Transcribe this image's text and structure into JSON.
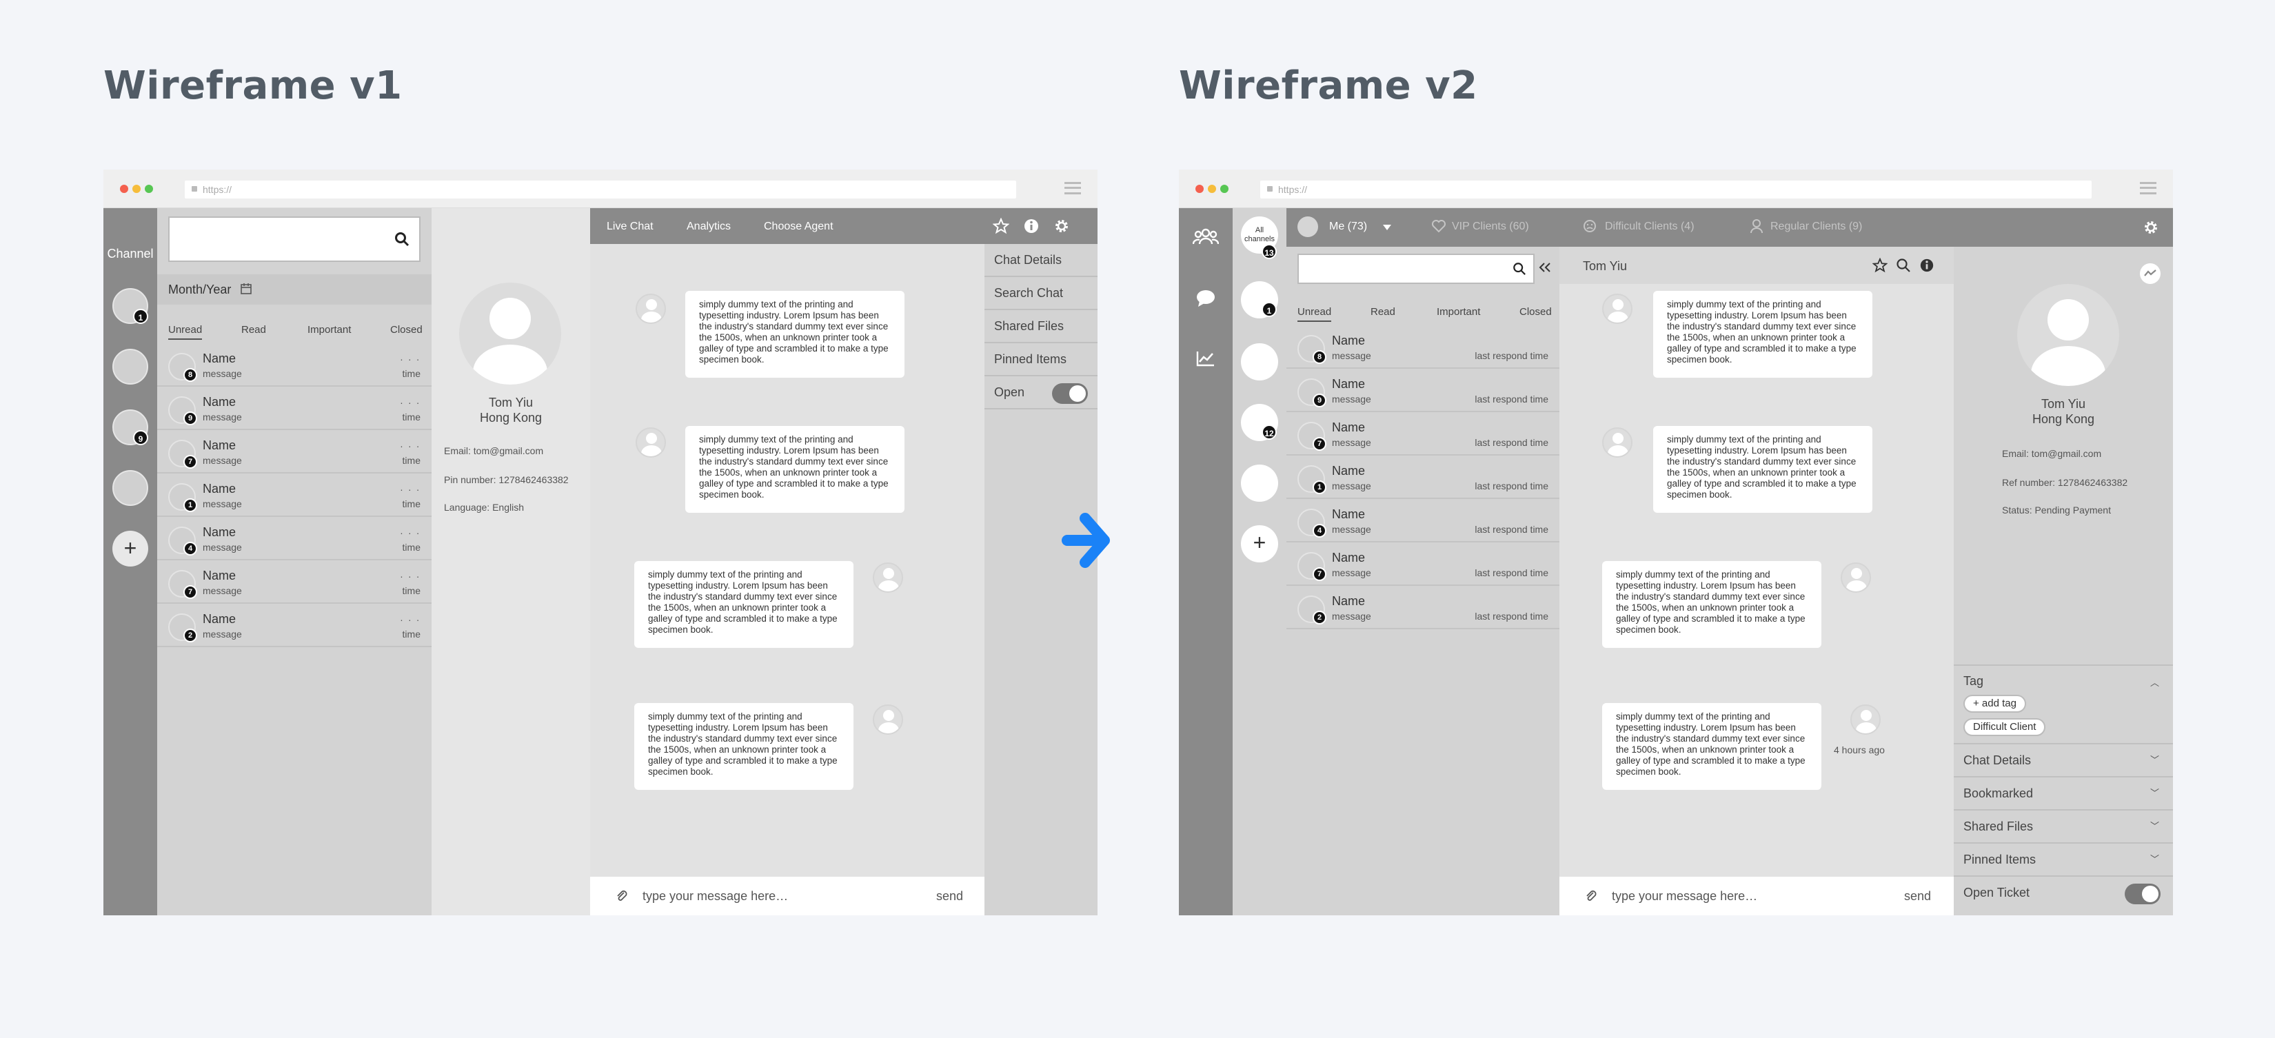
{
  "headings": {
    "v1": "Wireframe v1",
    "v2": "Wireframe v2"
  },
  "browser": {
    "url": "https://"
  },
  "v1": {
    "channel_label": "Channel",
    "channel_badges": [
      "1",
      "9"
    ],
    "month_year": "Month/Year",
    "tabs": [
      "Unread",
      "Read",
      "Important",
      "Closed"
    ],
    "rows": [
      {
        "name": "Name",
        "message": "message",
        "time": "time",
        "badge": "8"
      },
      {
        "name": "Name",
        "message": "message",
        "time": "time",
        "badge": "9"
      },
      {
        "name": "Name",
        "message": "message",
        "time": "time",
        "badge": "7"
      },
      {
        "name": "Name",
        "message": "message",
        "time": "time",
        "badge": "1"
      },
      {
        "name": "Name",
        "message": "message",
        "time": "time",
        "badge": "4"
      },
      {
        "name": "Name",
        "message": "message",
        "time": "time",
        "badge": "7"
      },
      {
        "name": "Name",
        "message": "message",
        "time": "time",
        "badge": "2"
      }
    ],
    "row_dots": ". . .",
    "profile": {
      "name": "Tom Yiu",
      "location": "Hong Kong",
      "email": "Email: tom@gmail.com",
      "pin": "Pin number: 1278462463382",
      "language": "Language: English"
    },
    "nav": [
      "Live Chat",
      "Analytics",
      "Choose Agent"
    ],
    "right_panel": [
      "Chat Details",
      "Search Chat",
      "Shared Files",
      "Pinned Items"
    ],
    "open_label": "Open",
    "composer": {
      "placeholder": "type your message here…",
      "send": "send"
    }
  },
  "message_text": "simply dummy text of the printing and typesetting industry. Lorem Ipsum has been the industry's standard dummy text ever since the 1500s, when an unknown printer took a galley of type and scrambled it to make a type specimen book.",
  "v2": {
    "all_channels": "All channels",
    "channel_badges": [
      "13",
      "1",
      "12"
    ],
    "me_label": "Me (73)",
    "filters": [
      "VIP Clients (60)",
      "Difficult Clients (4)",
      "Regular Clients (9)"
    ],
    "tabs": [
      "Unread",
      "Read",
      "Important",
      "Closed"
    ],
    "rows": [
      {
        "name": "Name",
        "message": "message",
        "time": "last respond time",
        "badge": "8"
      },
      {
        "name": "Name",
        "message": "message",
        "time": "last respond time",
        "badge": "9"
      },
      {
        "name": "Name",
        "message": "message",
        "time": "last respond time",
        "badge": "7"
      },
      {
        "name": "Name",
        "message": "message",
        "time": "last respond time",
        "badge": "1"
      },
      {
        "name": "Name",
        "message": "message",
        "time": "last respond time",
        "badge": "4"
      },
      {
        "name": "Name",
        "message": "message",
        "time": "last respond time",
        "badge": "7"
      },
      {
        "name": "Name",
        "message": "message",
        "time": "last respond time",
        "badge": "2"
      }
    ],
    "chat_title": "Tom Yiu",
    "timestamp": "4 hours ago",
    "profile": {
      "name": "Tom Yiu",
      "location": "Hong Kong",
      "email": "Email: tom@gmail.com",
      "ref": "Ref number: 1278462463382",
      "status": "Status: Pending Payment"
    },
    "tag_label": "Tag",
    "tags": [
      "+ add tag",
      "Difficult Client"
    ],
    "sections": [
      "Chat Details",
      "Bookmarked",
      "Shared Files",
      "Pinned Items"
    ],
    "open_ticket": "Open Ticket",
    "composer": {
      "placeholder": "type your message here…",
      "send": "send"
    }
  },
  "colors": {
    "arrow": "#1a82f7",
    "sidebar": "#8a8a8a",
    "panel": "#d3d3d3"
  }
}
